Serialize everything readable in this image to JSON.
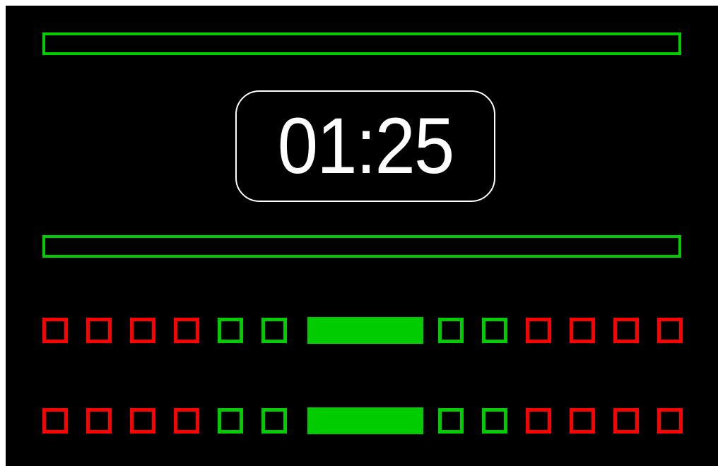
{
  "timer": {
    "display": "01:25"
  },
  "progress_bars": [
    {
      "name": "top-bar",
      "fill": 0.0
    },
    {
      "name": "bottom-bar",
      "fill": 0.0
    }
  ],
  "indicator_rows": [
    {
      "left": [
        "red",
        "red",
        "red",
        "red",
        "green",
        "green"
      ],
      "center_active": true,
      "right": [
        "green",
        "green",
        "red",
        "red",
        "red",
        "red"
      ]
    },
    {
      "left": [
        "red",
        "red",
        "red",
        "red",
        "green",
        "green"
      ],
      "center_active": true,
      "right": [
        "green",
        "green",
        "red",
        "red",
        "red",
        "red"
      ]
    }
  ],
  "colors": {
    "background": "#000000",
    "green": "#00cc00",
    "red": "#ff0000",
    "timer": "#ffffff"
  }
}
